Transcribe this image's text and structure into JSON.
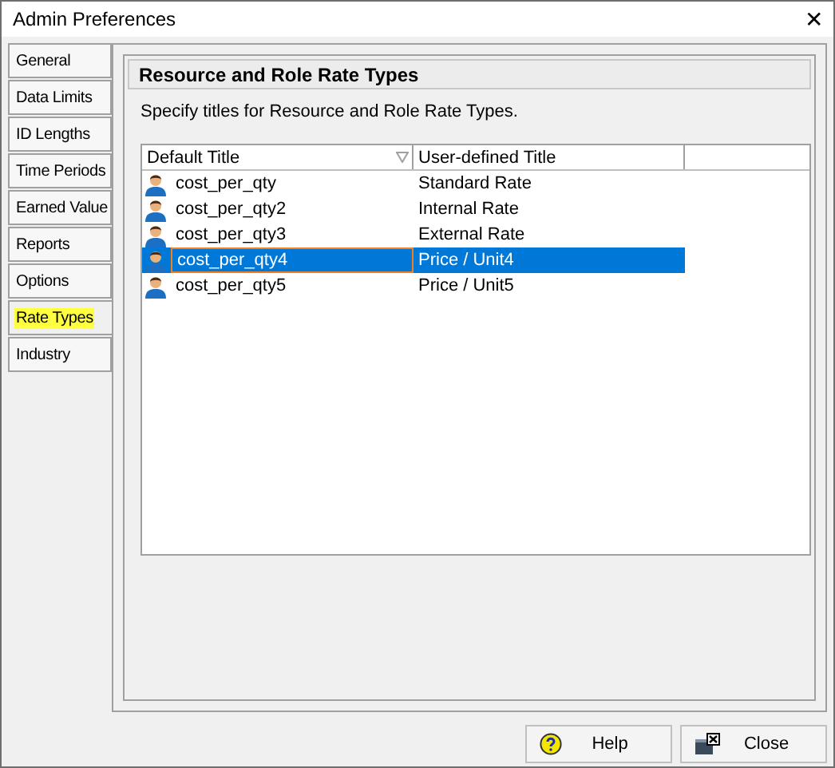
{
  "window": {
    "title": "Admin Preferences",
    "close": "✕"
  },
  "tabs": [
    {
      "label": "General",
      "selected": false,
      "highlighted": false
    },
    {
      "label": "Data Limits",
      "selected": false,
      "highlighted": false
    },
    {
      "label": "ID Lengths",
      "selected": false,
      "highlighted": false
    },
    {
      "label": "Time Periods",
      "selected": false,
      "highlighted": false
    },
    {
      "label": "Earned Value",
      "selected": false,
      "highlighted": false
    },
    {
      "label": "Reports",
      "selected": false,
      "highlighted": false
    },
    {
      "label": "Options",
      "selected": false,
      "highlighted": false
    },
    {
      "label": "Rate Types",
      "selected": true,
      "highlighted": true
    },
    {
      "label": "Industry",
      "selected": false,
      "highlighted": false
    }
  ],
  "panel": {
    "title": "Resource and Role Rate Types",
    "description": "Specify titles for Resource and Role Rate Types."
  },
  "table": {
    "columns": [
      "Default Title",
      "User-defined Title"
    ],
    "rows": [
      {
        "default": "cost_per_qty",
        "user": "Standard Rate",
        "selected": false
      },
      {
        "default": "cost_per_qty2",
        "user": "Internal Rate",
        "selected": false
      },
      {
        "default": "cost_per_qty3",
        "user": "External Rate",
        "selected": false
      },
      {
        "default": "cost_per_qty4",
        "user": "Price / Unit4",
        "selected": true
      },
      {
        "default": "cost_per_qty5",
        "user": "Price / Unit5",
        "selected": false
      }
    ]
  },
  "buttons": [
    {
      "label": "Help",
      "kind": "help"
    },
    {
      "label": "Close",
      "kind": "close"
    }
  ]
}
